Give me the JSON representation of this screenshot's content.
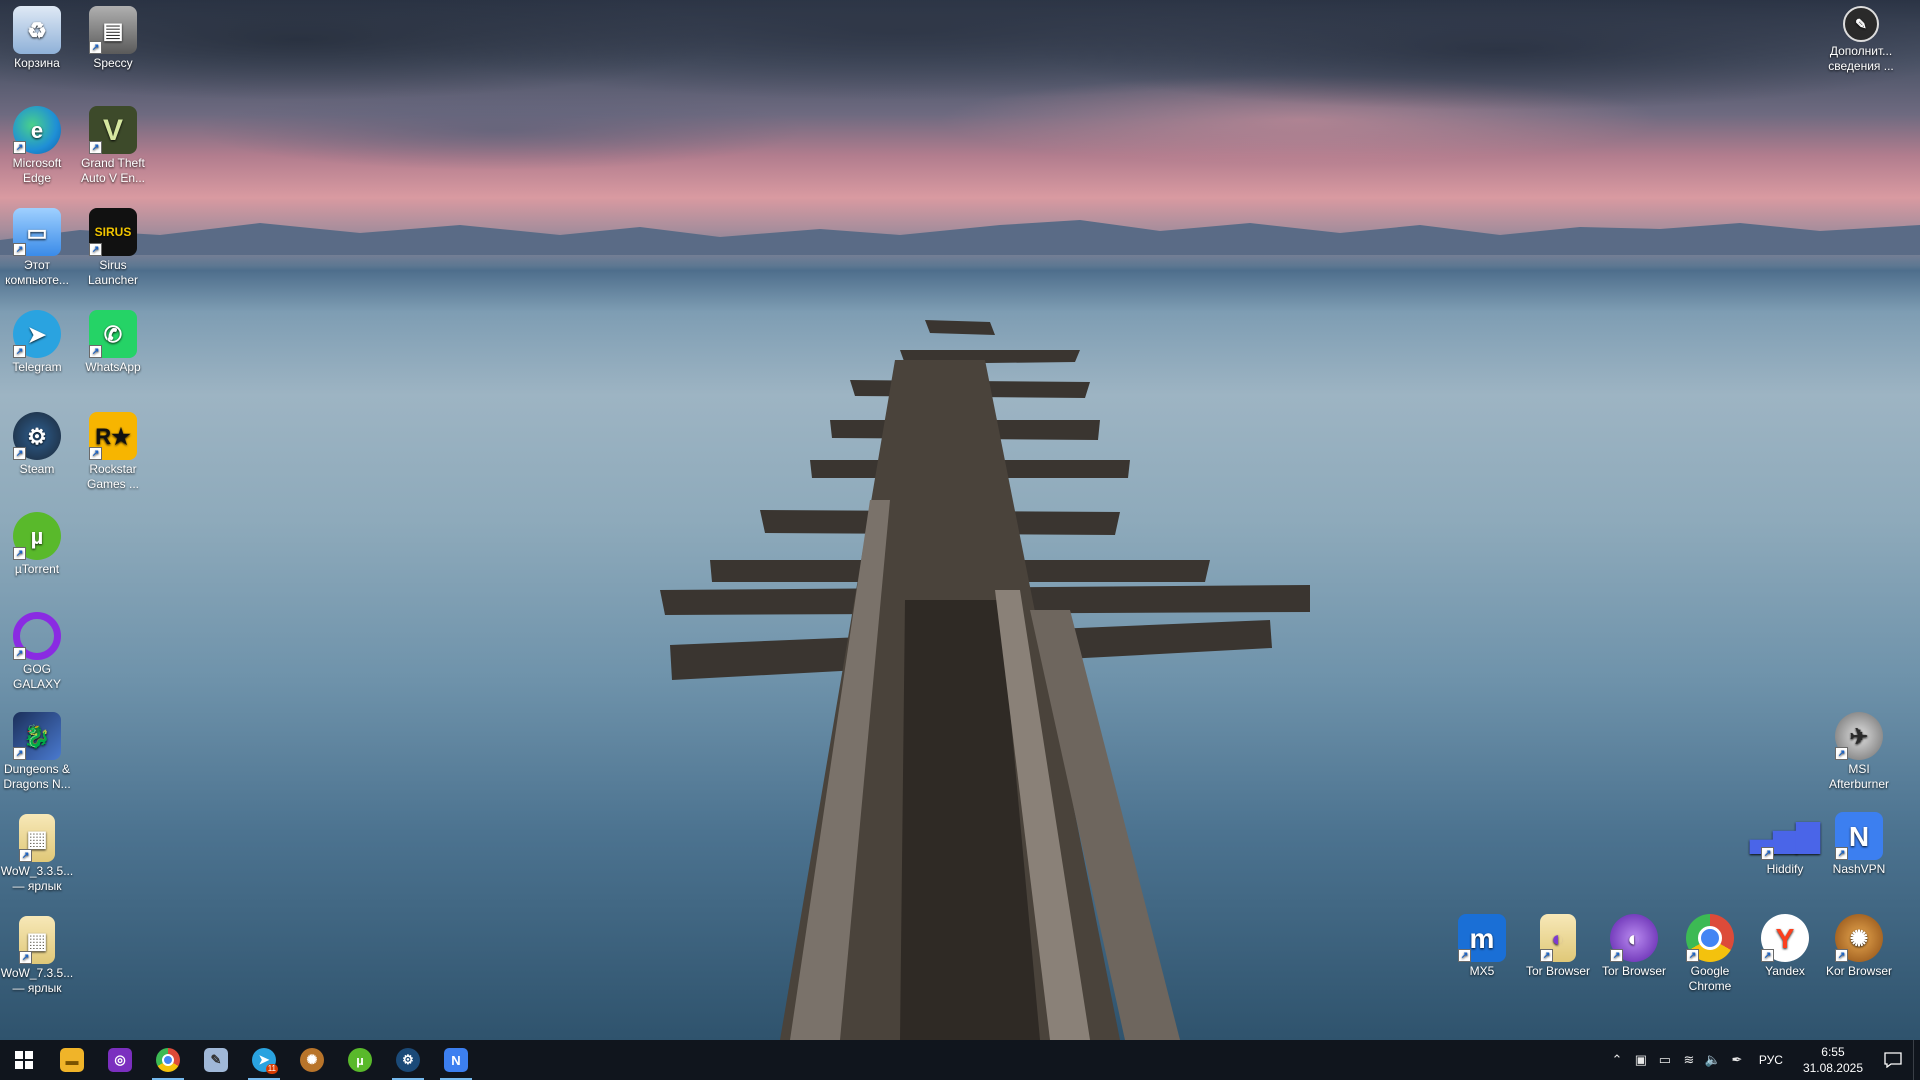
{
  "desktop": {
    "icons_left": [
      {
        "name": "recycle-bin-icon",
        "label": "Корзина",
        "color": "#5a8fd6"
      },
      {
        "name": "speccy-icon",
        "label": "Speccy",
        "color": "#8c8c8c"
      },
      {
        "name": "microsoft-edge-icon",
        "label": "Microsoft Edge",
        "color": "#1f8fd6"
      },
      {
        "name": "gta-v-icon",
        "label": "Grand Theft Auto V En...",
        "color": "#3d4a2a"
      },
      {
        "name": "this-pc-icon",
        "label": "Этот компьюте...",
        "color": "#3a8be8"
      },
      {
        "name": "sirus-launcher-icon",
        "label": "Sirus Launcher",
        "color": "#111111"
      },
      {
        "name": "telegram-icon",
        "label": "Telegram",
        "color": "#2aa3e0"
      },
      {
        "name": "whatsapp-icon",
        "label": "WhatsApp",
        "color": "#25d366"
      },
      {
        "name": "steam-icon",
        "label": "Steam",
        "color": "#1b2838"
      },
      {
        "name": "rockstar-games-icon",
        "label": "Rockstar Games ...",
        "color": "#f7b500"
      },
      {
        "name": "utorrent-icon",
        "label": "µTorrent",
        "color": "#59b92b"
      },
      {
        "name": "gog-galaxy-icon",
        "label": "GOG GALAXY",
        "color": "#8a2be2"
      },
      {
        "name": "dungeons-dragons-icon",
        "label": "Dungeons & Dragons N...",
        "color": "#2a4a8a"
      },
      {
        "name": "wow-335-folder-icon",
        "label": "WoW_3.3.5... — ярлык",
        "color": "#f0dc9c"
      },
      {
        "name": "wow-735-folder-icon",
        "label": "WoW_7.3.5... — ярлык",
        "color": "#f0dc9c"
      }
    ],
    "icons_right": [
      {
        "name": "additional-info-icon",
        "label": "Дополнит... сведения ...",
        "color": "#2a2a2a"
      },
      {
        "name": "msi-afterburner-icon",
        "label": "MSI Afterburner",
        "color": "#9a9a9a"
      },
      {
        "name": "hiddify-icon",
        "label": "Hiddify",
        "color": "#3a55d8"
      },
      {
        "name": "nashvpn-icon",
        "label": "NashVPN",
        "color": "#3c7ff0"
      },
      {
        "name": "mx5-icon",
        "label": "MX5",
        "color": "#1a6fd6"
      },
      {
        "name": "tor-browser-1-icon",
        "label": "Tor Browser",
        "color": "#f0d78c"
      },
      {
        "name": "tor-browser-2-icon",
        "label": "Tor Browser",
        "color": "#7e3bd0"
      },
      {
        "name": "google-chrome-icon",
        "label": "Google Chrome",
        "color": "#dd4b39"
      },
      {
        "name": "yandex-icon",
        "label": "Yandex",
        "color": "#ffffff"
      },
      {
        "name": "kor-browser-icon",
        "label": "Kor Browser",
        "color": "#b8742a"
      }
    ]
  },
  "taskbar": {
    "start_label": "⊞",
    "pinned": [
      {
        "name": "file-explorer-icon",
        "color": "#f0b429",
        "glyph": "▬"
      },
      {
        "name": "pinned-app-purple-icon",
        "color": "#7b2fbf",
        "glyph": "◎"
      },
      {
        "name": "chrome-icon",
        "color": "#dd4b39",
        "glyph": "●"
      },
      {
        "name": "paint-icon",
        "color": "#a0b8d8",
        "glyph": "✎"
      },
      {
        "name": "telegram-icon",
        "color": "#2aa3e0",
        "glyph": "➤",
        "badge": "11"
      },
      {
        "name": "kor-browser-icon",
        "color": "#b8742a",
        "glyph": "✺"
      },
      {
        "name": "utorrent-icon",
        "color": "#59b92b",
        "glyph": "µ"
      },
      {
        "name": "steam-icon",
        "color": "#1b4a78",
        "glyph": "⚙"
      },
      {
        "name": "nashvpn-icon",
        "color": "#3c7ff0",
        "glyph": "N"
      }
    ],
    "tray": {
      "language": "РУС",
      "time": "6:55",
      "date": "31.08.2025"
    }
  }
}
